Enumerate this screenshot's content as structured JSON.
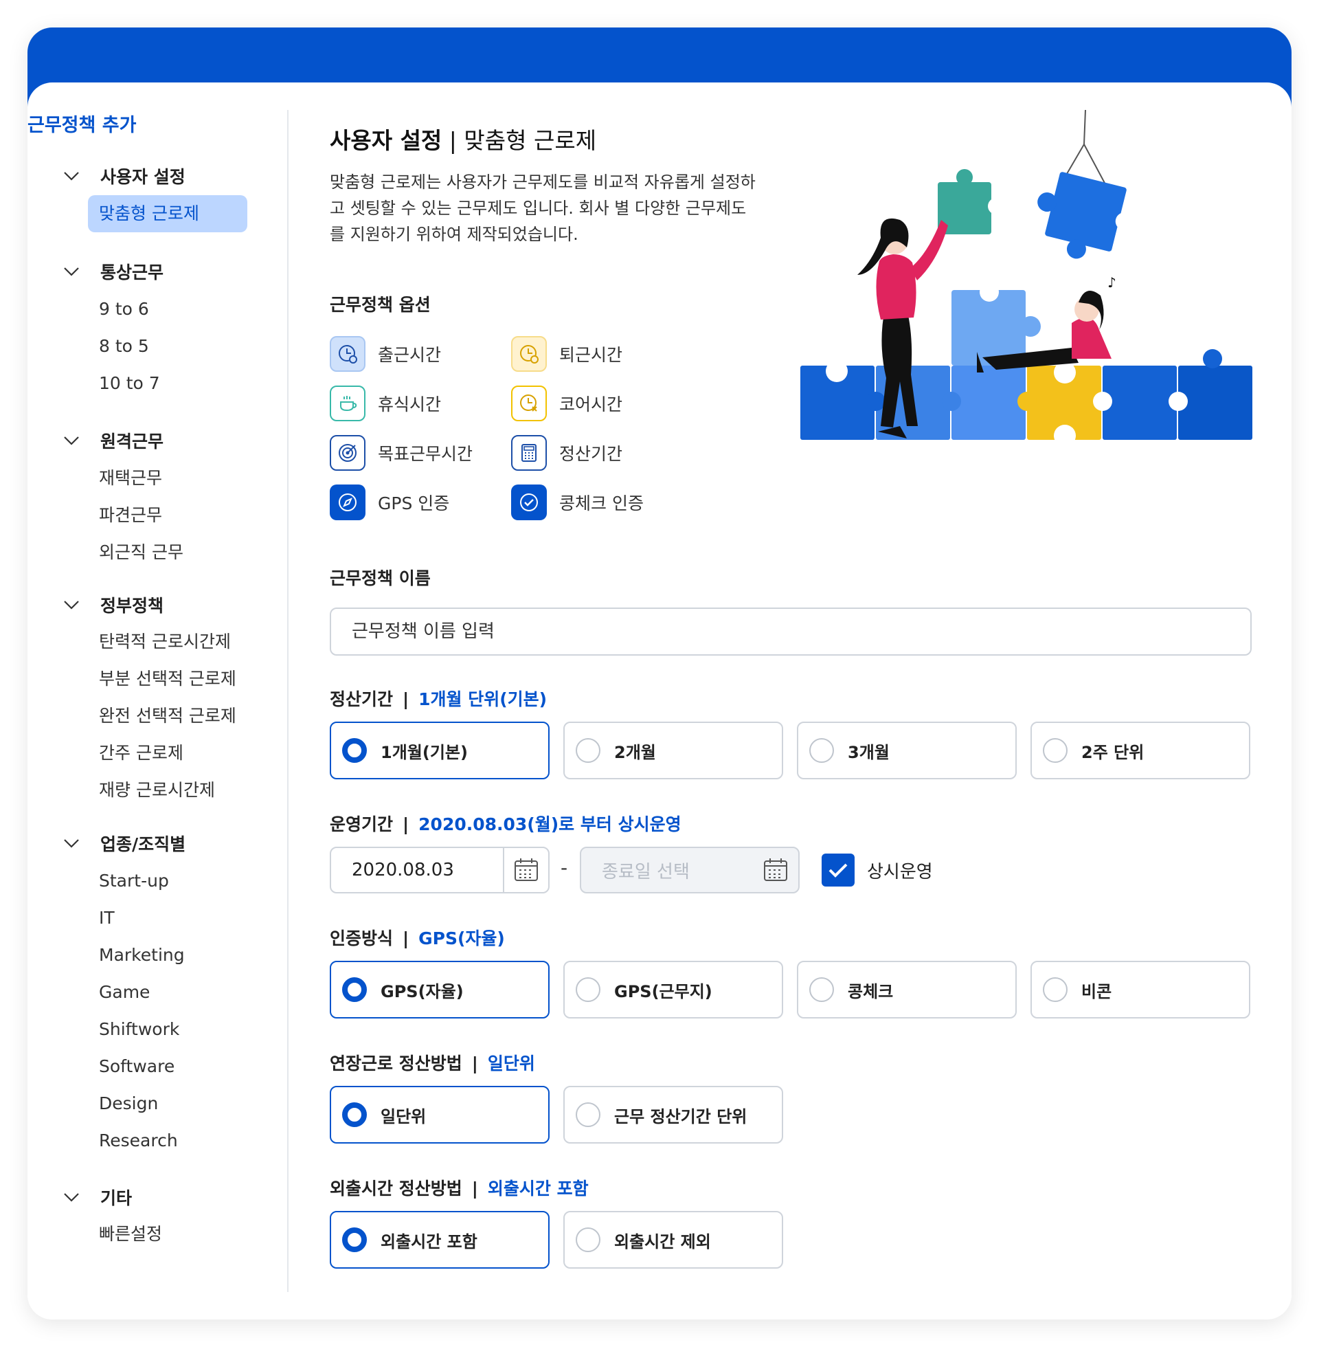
{
  "sidebar": {
    "title": "근무정책 추가",
    "groups": [
      {
        "label": "사용자 설정",
        "items": [
          "맞춤형 근로제"
        ]
      },
      {
        "label": "통상근무",
        "items": [
          "9 to 6",
          "8 to 5",
          "10 to 7"
        ]
      },
      {
        "label": "원격근무",
        "items": [
          "재택근무",
          "파견근무",
          "외근직 근무"
        ]
      },
      {
        "label": "정부정책",
        "items": [
          "탄력적 근로시간제",
          "부분 선택적 근로제",
          "완전 선택적 근로제",
          "간주 근로제",
          "재량 근로시간제"
        ]
      },
      {
        "label": "업종/조직별",
        "items": [
          "Start-up",
          "IT",
          "Marketing",
          "Game",
          "Shiftwork",
          "Software",
          "Design",
          "Research"
        ]
      },
      {
        "label": "기타",
        "items": [
          "빠른설정"
        ]
      }
    ]
  },
  "header": {
    "title_strong": "사용자 설정",
    "title_sep": " | ",
    "title_rest": "맞춤형 근로제",
    "description": "맞춤형 근로제는 사용자가 근무제도를 비교적 자유롭게 설정하고 셋팅할 수 있는 근무제도 입니다. 회사 별 다양한 근무제도를 지원하기 위하여 제작되었습니다."
  },
  "options": {
    "label": "근무정책 옵션",
    "items": [
      {
        "label": "출근시간",
        "icon": "clock-in-icon"
      },
      {
        "label": "퇴근시간",
        "icon": "clock-out-icon"
      },
      {
        "label": "휴식시간",
        "icon": "coffee-cup-icon"
      },
      {
        "label": "코어시간",
        "icon": "core-time-icon"
      },
      {
        "label": "목표근무시간",
        "icon": "target-icon"
      },
      {
        "label": "정산기간",
        "icon": "calculator-icon"
      },
      {
        "label": "GPS 인증",
        "icon": "compass-icon"
      },
      {
        "label": "콩체크 인증",
        "icon": "check-circle-icon"
      }
    ]
  },
  "name_field": {
    "label": "근무정책 이름",
    "placeholder": "근무정책 이름 입력"
  },
  "settlement": {
    "label": "정산기간",
    "sep": "|",
    "value": "1개월 단위(기본)",
    "options": [
      "1개월(기본)",
      "2개월",
      "3개월",
      "2주 단위"
    ],
    "selected": 0
  },
  "operation": {
    "label": "운영기간",
    "sep": "|",
    "value": "2020.08.03(월)로 부터 상시운영",
    "start_date": "2020.08.03",
    "dash": "-",
    "end_placeholder": "종료일 선택",
    "always_label": "상시운영",
    "always_checked": true
  },
  "auth": {
    "label": "인증방식",
    "sep": "|",
    "value": "GPS(자율)",
    "options": [
      "GPS(자율)",
      "GPS(근무지)",
      "콩체크",
      "비콘"
    ],
    "selected": 0
  },
  "overtime": {
    "label": "연장근로 정산방법",
    "sep": "|",
    "value": "일단위",
    "options": [
      "일단위",
      "근무 정산기간 단위"
    ],
    "selected": 0
  },
  "outing": {
    "label": "외출시간 정산방법",
    "sep": "|",
    "value": "외출시간 포함",
    "options": [
      "외출시간 포함",
      "외출시간 제외"
    ],
    "selected": 0
  },
  "colors": {
    "brand": "#0453cc",
    "active_bg": "#bcd6ff",
    "border": "#cfd4db"
  }
}
